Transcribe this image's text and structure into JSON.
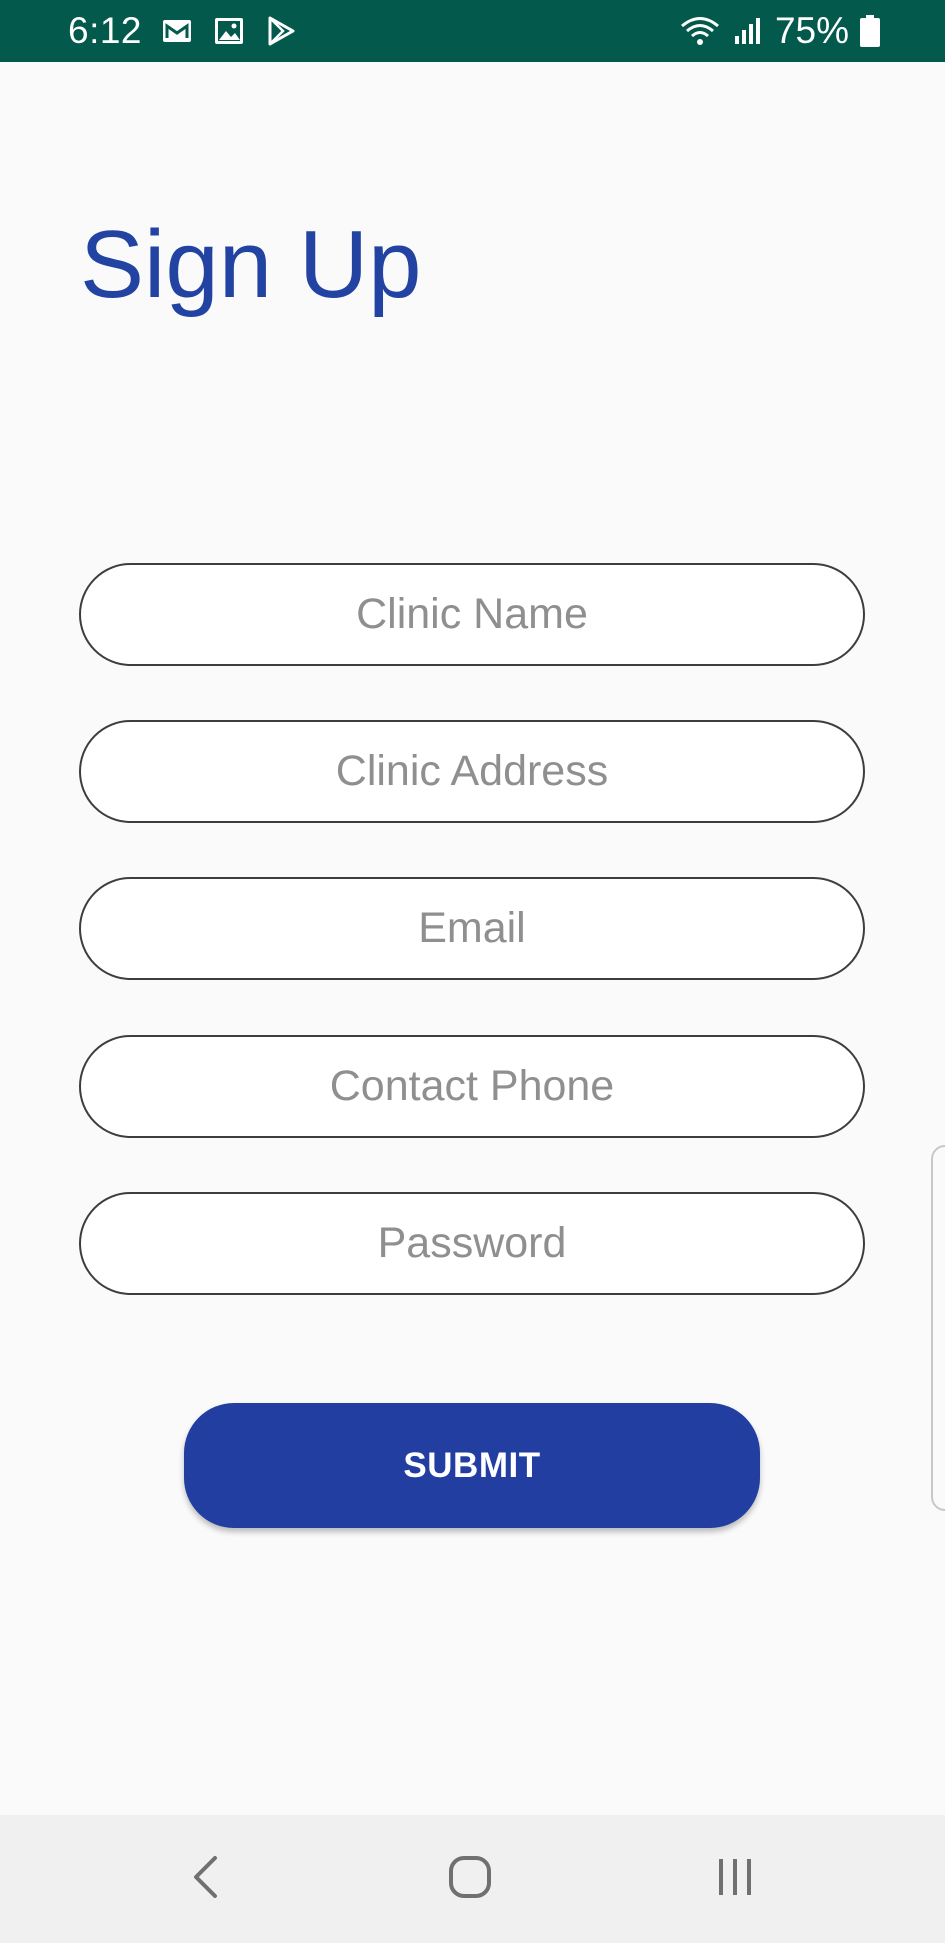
{
  "status_bar": {
    "time": "6:12",
    "battery_percent": "75%",
    "icons": [
      "gmail-icon",
      "image-icon",
      "play-store-icon",
      "wifi-icon",
      "signal-icon",
      "battery-icon"
    ],
    "background_color": "#035a4c"
  },
  "title": "Sign Up",
  "form": {
    "fields": [
      {
        "placeholder": "Clinic Name",
        "value": ""
      },
      {
        "placeholder": "Clinic Address",
        "value": ""
      },
      {
        "placeholder": "Email",
        "value": ""
      },
      {
        "placeholder": "Contact Phone",
        "value": ""
      },
      {
        "placeholder": "Password",
        "value": ""
      }
    ],
    "submit_label": "SUBMIT"
  },
  "nav_bar": {
    "icons": [
      "back-icon",
      "home-icon",
      "recents-icon"
    ]
  },
  "colors": {
    "accent": "#2243a1",
    "button": "#223ea0",
    "background": "#fafafa"
  }
}
